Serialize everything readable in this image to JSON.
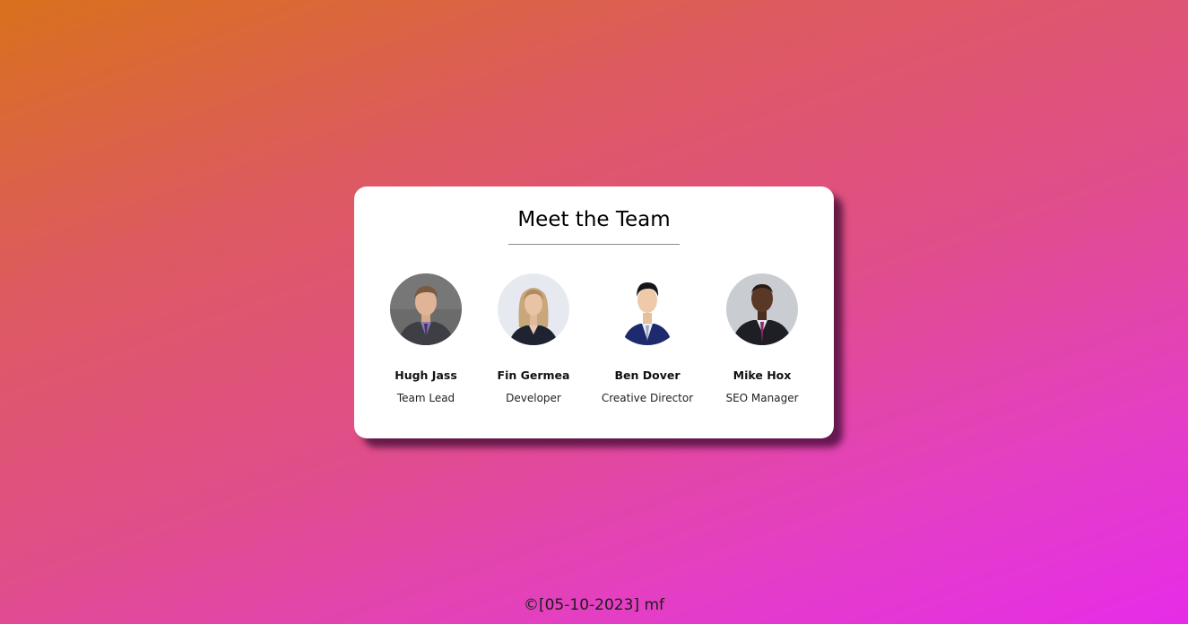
{
  "card": {
    "title": "Meet the Team"
  },
  "team": [
    {
      "name": "Hugh Jass",
      "role": "Team Lead",
      "photo": "portrait-man-grey-suit"
    },
    {
      "name": "Fin Germea",
      "role": "Developer",
      "photo": "portrait-woman-blazer"
    },
    {
      "name": "Ben Dover",
      "role": "Creative Director",
      "photo": "portrait-man-navy-suit"
    },
    {
      "name": "Mike Hox",
      "role": "SEO Manager",
      "photo": "portrait-man-dark-suit"
    }
  ],
  "footer": {
    "text": "©[05-10-2023] mf"
  }
}
